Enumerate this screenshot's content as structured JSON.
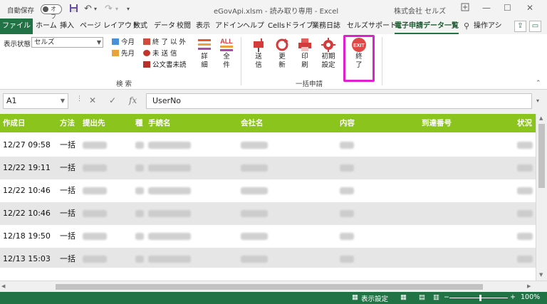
{
  "titlebar": {
    "autosave_label": "自動保存",
    "autosave_state": "オフ",
    "title": "eGovApi.xlsm  -  読み取り専用  -  Excel",
    "company": "株式会社 セルズ"
  },
  "tabs": [
    {
      "label": "ファイル"
    },
    {
      "label": "ホーム"
    },
    {
      "label": "挿入"
    },
    {
      "label": "ページ レイアウト"
    },
    {
      "label": "数式"
    },
    {
      "label": "データ"
    },
    {
      "label": "校閲"
    },
    {
      "label": "表示"
    },
    {
      "label": "アドイン"
    },
    {
      "label": "ヘルプ"
    },
    {
      "label": "Cellsドライブ"
    },
    {
      "label": "業務日誌"
    },
    {
      "label": "セルズサポート"
    },
    {
      "label": "電子申請データ一覧"
    },
    {
      "label": "操作アシ"
    }
  ],
  "ribbon": {
    "display_state_label": "表示状態",
    "display_state_value": "セルズ",
    "this_month": "今月",
    "last_month": "先月",
    "done_except": "終 了 以 外",
    "unsent": "未 送 信",
    "unread_docs": "公文書未読",
    "search_group": "検 索",
    "detail": [
      "詳",
      "細"
    ],
    "all": [
      "全",
      "件"
    ],
    "send": [
      "送",
      "信"
    ],
    "update": [
      "更",
      "新"
    ],
    "print": [
      "印",
      "刷"
    ],
    "init_settings": [
      "初期",
      "設定"
    ],
    "exit": [
      "終",
      "了"
    ],
    "exit_icon_text": "EXIT",
    "all_icon_text": "ALL",
    "batch_group": "一括申請"
  },
  "formula": {
    "cell_ref": "A1",
    "content": "UserNo"
  },
  "grid": {
    "headers": [
      "作成日",
      "方法",
      "提出先",
      "種",
      "手続名",
      "会社名",
      "内容",
      "到達番号",
      "状況"
    ],
    "rows": [
      {
        "date": "12/27 09:58",
        "method": "一括"
      },
      {
        "date": "12/22 19:11",
        "method": "一括"
      },
      {
        "date": "12/22 10:46",
        "method": "一括"
      },
      {
        "date": "12/22 10:46",
        "method": "一括"
      },
      {
        "date": "12/18 19:50",
        "method": "一括"
      },
      {
        "date": "12/13 15:03",
        "method": "一括"
      }
    ]
  },
  "statusbar": {
    "display_settings": "表示設定",
    "zoom": "100%"
  },
  "colors": {
    "excel_green": "#217346",
    "header_green": "#8cc41e",
    "highlight_magenta": "#e020d0"
  }
}
